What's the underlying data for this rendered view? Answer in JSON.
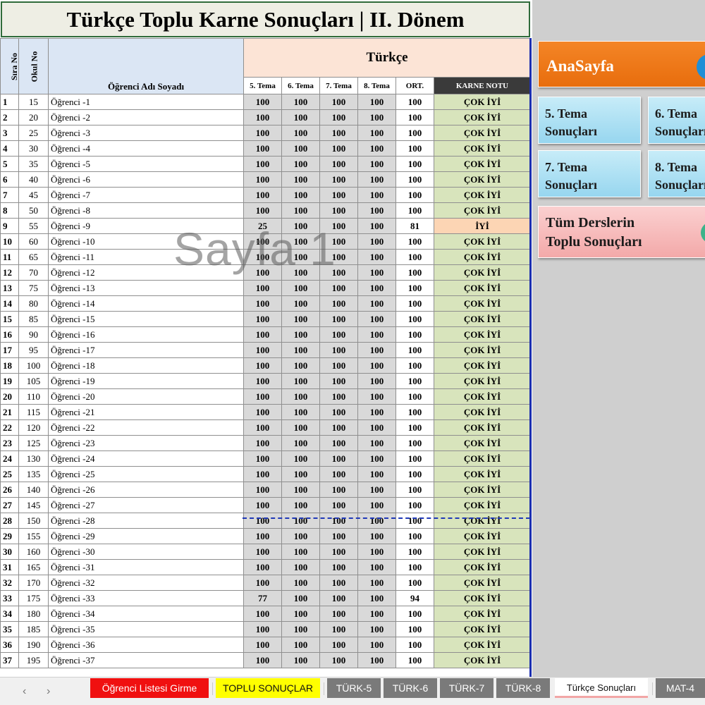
{
  "title": "Türkçe Toplu Karne Sonuçları | II. Dönem",
  "watermark": "Sayfa 1",
  "table": {
    "headers": {
      "sira_no": "Sıra No",
      "okul_no": "Okul No",
      "ad_soyad": "Öğrenci Adı Soyadı",
      "subject": "Türkçe",
      "tema5": "5. Tema",
      "tema6": "6. Tema",
      "tema7": "7. Tema",
      "tema8": "8. Tema",
      "ort": "ORT.",
      "karne_notu": "KARNE NOTU"
    },
    "rows": [
      {
        "sira": "1",
        "okul": "15",
        "ad": "Öğrenci -1",
        "t5": "100",
        "t6": "100",
        "t7": "100",
        "t8": "100",
        "ort": "100",
        "not": "ÇOK İYİ"
      },
      {
        "sira": "2",
        "okul": "20",
        "ad": "Öğrenci -2",
        "t5": "100",
        "t6": "100",
        "t7": "100",
        "t8": "100",
        "ort": "100",
        "not": "ÇOK İYİ"
      },
      {
        "sira": "3",
        "okul": "25",
        "ad": "Öğrenci -3",
        "t5": "100",
        "t6": "100",
        "t7": "100",
        "t8": "100",
        "ort": "100",
        "not": "ÇOK İYİ"
      },
      {
        "sira": "4",
        "okul": "30",
        "ad": "Öğrenci -4",
        "t5": "100",
        "t6": "100",
        "t7": "100",
        "t8": "100",
        "ort": "100",
        "not": "ÇOK İYİ"
      },
      {
        "sira": "5",
        "okul": "35",
        "ad": "Öğrenci -5",
        "t5": "100",
        "t6": "100",
        "t7": "100",
        "t8": "100",
        "ort": "100",
        "not": "ÇOK İYİ"
      },
      {
        "sira": "6",
        "okul": "40",
        "ad": "Öğrenci -6",
        "t5": "100",
        "t6": "100",
        "t7": "100",
        "t8": "100",
        "ort": "100",
        "not": "ÇOK İYİ"
      },
      {
        "sira": "7",
        "okul": "45",
        "ad": "Öğrenci -7",
        "t5": "100",
        "t6": "100",
        "t7": "100",
        "t8": "100",
        "ort": "100",
        "not": "ÇOK İYİ"
      },
      {
        "sira": "8",
        "okul": "50",
        "ad": "Öğrenci -8",
        "t5": "100",
        "t6": "100",
        "t7": "100",
        "t8": "100",
        "ort": "100",
        "not": "ÇOK İYİ"
      },
      {
        "sira": "9",
        "okul": "55",
        "ad": "Öğrenci -9",
        "t5": "25",
        "t6": "100",
        "t7": "100",
        "t8": "100",
        "ort": "81",
        "not": "İYİ"
      },
      {
        "sira": "10",
        "okul": "60",
        "ad": "Öğrenci -10",
        "t5": "100",
        "t6": "100",
        "t7": "100",
        "t8": "100",
        "ort": "100",
        "not": "ÇOK İYİ"
      },
      {
        "sira": "11",
        "okul": "65",
        "ad": "Öğrenci -11",
        "t5": "100",
        "t6": "100",
        "t7": "100",
        "t8": "100",
        "ort": "100",
        "not": "ÇOK İYİ"
      },
      {
        "sira": "12",
        "okul": "70",
        "ad": "Öğrenci -12",
        "t5": "100",
        "t6": "100",
        "t7": "100",
        "t8": "100",
        "ort": "100",
        "not": "ÇOK İYİ"
      },
      {
        "sira": "13",
        "okul": "75",
        "ad": "Öğrenci -13",
        "t5": "100",
        "t6": "100",
        "t7": "100",
        "t8": "100",
        "ort": "100",
        "not": "ÇOK İYİ"
      },
      {
        "sira": "14",
        "okul": "80",
        "ad": "Öğrenci -14",
        "t5": "100",
        "t6": "100",
        "t7": "100",
        "t8": "100",
        "ort": "100",
        "not": "ÇOK İYİ"
      },
      {
        "sira": "15",
        "okul": "85",
        "ad": "Öğrenci -15",
        "t5": "100",
        "t6": "100",
        "t7": "100",
        "t8": "100",
        "ort": "100",
        "not": "ÇOK İYİ"
      },
      {
        "sira": "16",
        "okul": "90",
        "ad": "Öğrenci -16",
        "t5": "100",
        "t6": "100",
        "t7": "100",
        "t8": "100",
        "ort": "100",
        "not": "ÇOK İYİ"
      },
      {
        "sira": "17",
        "okul": "95",
        "ad": "Öğrenci -17",
        "t5": "100",
        "t6": "100",
        "t7": "100",
        "t8": "100",
        "ort": "100",
        "not": "ÇOK İYİ"
      },
      {
        "sira": "18",
        "okul": "100",
        "ad": "Öğrenci -18",
        "t5": "100",
        "t6": "100",
        "t7": "100",
        "t8": "100",
        "ort": "100",
        "not": "ÇOK İYİ"
      },
      {
        "sira": "19",
        "okul": "105",
        "ad": "Öğrenci -19",
        "t5": "100",
        "t6": "100",
        "t7": "100",
        "t8": "100",
        "ort": "100",
        "not": "ÇOK İYİ"
      },
      {
        "sira": "20",
        "okul": "110",
        "ad": "Öğrenci -20",
        "t5": "100",
        "t6": "100",
        "t7": "100",
        "t8": "100",
        "ort": "100",
        "not": "ÇOK İYİ"
      },
      {
        "sira": "21",
        "okul": "115",
        "ad": "Öğrenci -21",
        "t5": "100",
        "t6": "100",
        "t7": "100",
        "t8": "100",
        "ort": "100",
        "not": "ÇOK İYİ"
      },
      {
        "sira": "22",
        "okul": "120",
        "ad": "Öğrenci -22",
        "t5": "100",
        "t6": "100",
        "t7": "100",
        "t8": "100",
        "ort": "100",
        "not": "ÇOK İYİ"
      },
      {
        "sira": "23",
        "okul": "125",
        "ad": "Öğrenci -23",
        "t5": "100",
        "t6": "100",
        "t7": "100",
        "t8": "100",
        "ort": "100",
        "not": "ÇOK İYİ"
      },
      {
        "sira": "24",
        "okul": "130",
        "ad": "Öğrenci -24",
        "t5": "100",
        "t6": "100",
        "t7": "100",
        "t8": "100",
        "ort": "100",
        "not": "ÇOK İYİ"
      },
      {
        "sira": "25",
        "okul": "135",
        "ad": "Öğrenci -25",
        "t5": "100",
        "t6": "100",
        "t7": "100",
        "t8": "100",
        "ort": "100",
        "not": "ÇOK İYİ"
      },
      {
        "sira": "26",
        "okul": "140",
        "ad": "Öğrenci -26",
        "t5": "100",
        "t6": "100",
        "t7": "100",
        "t8": "100",
        "ort": "100",
        "not": "ÇOK İYİ"
      },
      {
        "sira": "27",
        "okul": "145",
        "ad": "Öğrenci -27",
        "t5": "100",
        "t6": "100",
        "t7": "100",
        "t8": "100",
        "ort": "100",
        "not": "ÇOK İYİ"
      },
      {
        "sira": "28",
        "okul": "150",
        "ad": "Öğrenci -28",
        "t5": "100",
        "t6": "100",
        "t7": "100",
        "t8": "100",
        "ort": "100",
        "not": "ÇOK İYİ"
      },
      {
        "sira": "29",
        "okul": "155",
        "ad": "Öğrenci -29",
        "t5": "100",
        "t6": "100",
        "t7": "100",
        "t8": "100",
        "ort": "100",
        "not": "ÇOK İYİ"
      },
      {
        "sira": "30",
        "okul": "160",
        "ad": "Öğrenci -30",
        "t5": "100",
        "t6": "100",
        "t7": "100",
        "t8": "100",
        "ort": "100",
        "not": "ÇOK İYİ"
      },
      {
        "sira": "31",
        "okul": "165",
        "ad": "Öğrenci -31",
        "t5": "100",
        "t6": "100",
        "t7": "100",
        "t8": "100",
        "ort": "100",
        "not": "ÇOK İYİ"
      },
      {
        "sira": "32",
        "okul": "170",
        "ad": "Öğrenci -32",
        "t5": "100",
        "t6": "100",
        "t7": "100",
        "t8": "100",
        "ort": "100",
        "not": "ÇOK İYİ"
      },
      {
        "sira": "33",
        "okul": "175",
        "ad": "Öğrenci -33",
        "t5": "77",
        "t6": "100",
        "t7": "100",
        "t8": "100",
        "ort": "94",
        "not": "ÇOK İYİ"
      },
      {
        "sira": "34",
        "okul": "180",
        "ad": "Öğrenci -34",
        "t5": "100",
        "t6": "100",
        "t7": "100",
        "t8": "100",
        "ort": "100",
        "not": "ÇOK İYİ"
      },
      {
        "sira": "35",
        "okul": "185",
        "ad": "Öğrenci -35",
        "t5": "100",
        "t6": "100",
        "t7": "100",
        "t8": "100",
        "ort": "100",
        "not": "ÇOK İYİ"
      },
      {
        "sira": "36",
        "okul": "190",
        "ad": "Öğrenci -36",
        "t5": "100",
        "t6": "100",
        "t7": "100",
        "t8": "100",
        "ort": "100",
        "not": "ÇOK İYİ"
      },
      {
        "sira": "37",
        "okul": "195",
        "ad": "Öğrenci -37",
        "t5": "100",
        "t6": "100",
        "t7": "100",
        "t8": "100",
        "ort": "100",
        "not": "ÇOK İYİ"
      }
    ]
  },
  "nav": {
    "anasayfa": "AnaSayfa",
    "tema5_line1": "5. Tema",
    "tema5_line2": "Sonuçları",
    "tema6_line1": "6. Tema",
    "tema6_line2": "Sonuçları",
    "tema7_line1": "7. Tema",
    "tema7_line2": "Sonuçları",
    "tema8_line1": "8. Tema",
    "tema8_line2": "Sonuçları",
    "tum_line1": "Tüm Derslerin",
    "tum_line2": "Toplu Sonuçları"
  },
  "tabs": {
    "prev_icon": "‹",
    "next_icon": "›",
    "items": [
      "Öğrenci Listesi Girme",
      "TOPLU SONUÇLAR",
      "TÜRK-5",
      "TÜRK-6",
      "TÜRK-7",
      "TÜRK-8",
      "Türkçe Sonuçları",
      "MAT-4"
    ],
    "active": "Türkçe Sonuçları"
  },
  "colors": {
    "title_border": "#2f6b3a",
    "header_blue": "#dbe6f4",
    "subject_peach": "#fce4d6",
    "score_grey": "#d9d9d9",
    "grade_green": "#d8e4bc",
    "grade_warn": "#fcd5b4",
    "anasayfa_orange": "#f48526",
    "tema_blue": "#b8e4f5",
    "tum_pink": "#f8c0c0",
    "tab_red": "#f01010",
    "tab_yellow": "#ffff00",
    "tab_grey": "#7a7a7a"
  }
}
